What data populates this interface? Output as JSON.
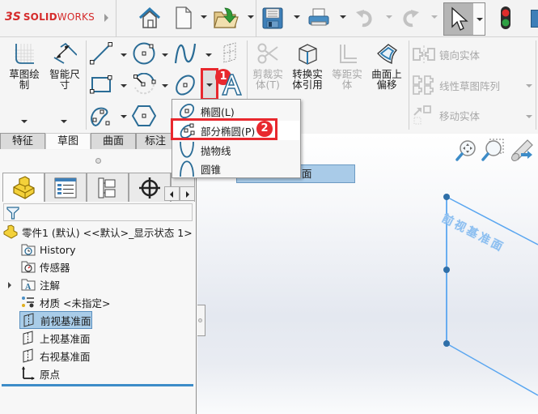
{
  "app": {
    "logo_ds": "3S",
    "logo_bold": "SOLID",
    "logo_light": "WORKS"
  },
  "toolbar": {
    "buttons": [
      {
        "name": "home",
        "icon": "home-icon"
      },
      {
        "name": "new-document",
        "icon": "new-document-icon"
      },
      {
        "name": "open",
        "icon": "open-folder-icon"
      },
      {
        "name": "save",
        "icon": "save-icon"
      },
      {
        "name": "print",
        "icon": "printer-icon"
      },
      {
        "name": "undo",
        "icon": "undo-icon",
        "disabled": true
      },
      {
        "name": "redo",
        "icon": "redo-icon",
        "disabled": true
      },
      {
        "name": "select",
        "icon": "cursor-arrow-icon",
        "active": true
      },
      {
        "name": "rebuild",
        "icon": "traffic-light-icon"
      }
    ]
  },
  "command_manager": {
    "sketch_label": "草图绘\n制",
    "sketch_label_l1": "草图绘",
    "sketch_label_l2": "制",
    "smart_dim_l1": "智能尺",
    "smart_dim_l2": "寸",
    "trim_l1": "剪裁实",
    "trim_l2": "体(T)",
    "convert_l1": "转换实",
    "convert_l2": "体引用",
    "offset_l1": "等距实",
    "offset_l2": "体",
    "offset_surface_l1": "曲面上",
    "offset_surface_l2": "偏移",
    "mirror": "镜向实体",
    "linear_pattern": "线性草图阵列",
    "move": "移动实体"
  },
  "tabs": [
    {
      "label": "特征",
      "active": false
    },
    {
      "label": "草图",
      "active": true
    },
    {
      "label": "曲面",
      "active": false
    },
    {
      "label": "标注",
      "active": false
    }
  ],
  "dropdown": {
    "items": [
      {
        "label": "椭圆(L)",
        "icon": "ellipse-icon"
      },
      {
        "label": "部分椭圆(P)",
        "icon": "partial-ellipse-icon",
        "highlighted": true
      },
      {
        "label": "抛物线",
        "icon": "parabola-icon"
      },
      {
        "label": "圆锥",
        "icon": "conic-icon"
      }
    ]
  },
  "annotations": {
    "badge1": "1",
    "badge2": "2",
    "highlight_color": "#e8282e"
  },
  "feature_manager": {
    "root": "零件1 (默认) <<默认>_显示状态 1>",
    "items": [
      {
        "label": "History",
        "icon": "history-folder-icon"
      },
      {
        "label": "传感器",
        "icon": "sensor-folder-icon"
      },
      {
        "label": "注解",
        "icon": "annotation-folder-icon",
        "expandable": true
      },
      {
        "label": "材质 <未指定>",
        "icon": "material-icon"
      },
      {
        "label": "前视基准面",
        "icon": "plane-icon",
        "selected": true
      },
      {
        "label": "上视基准面",
        "icon": "plane-icon"
      },
      {
        "label": "右视基准面",
        "icon": "plane-icon"
      },
      {
        "label": "原点",
        "icon": "origin-icon"
      }
    ]
  },
  "graphics": {
    "selection_tag": "面",
    "plane_label": "前视基准面",
    "accent": "#5aa6f0"
  }
}
